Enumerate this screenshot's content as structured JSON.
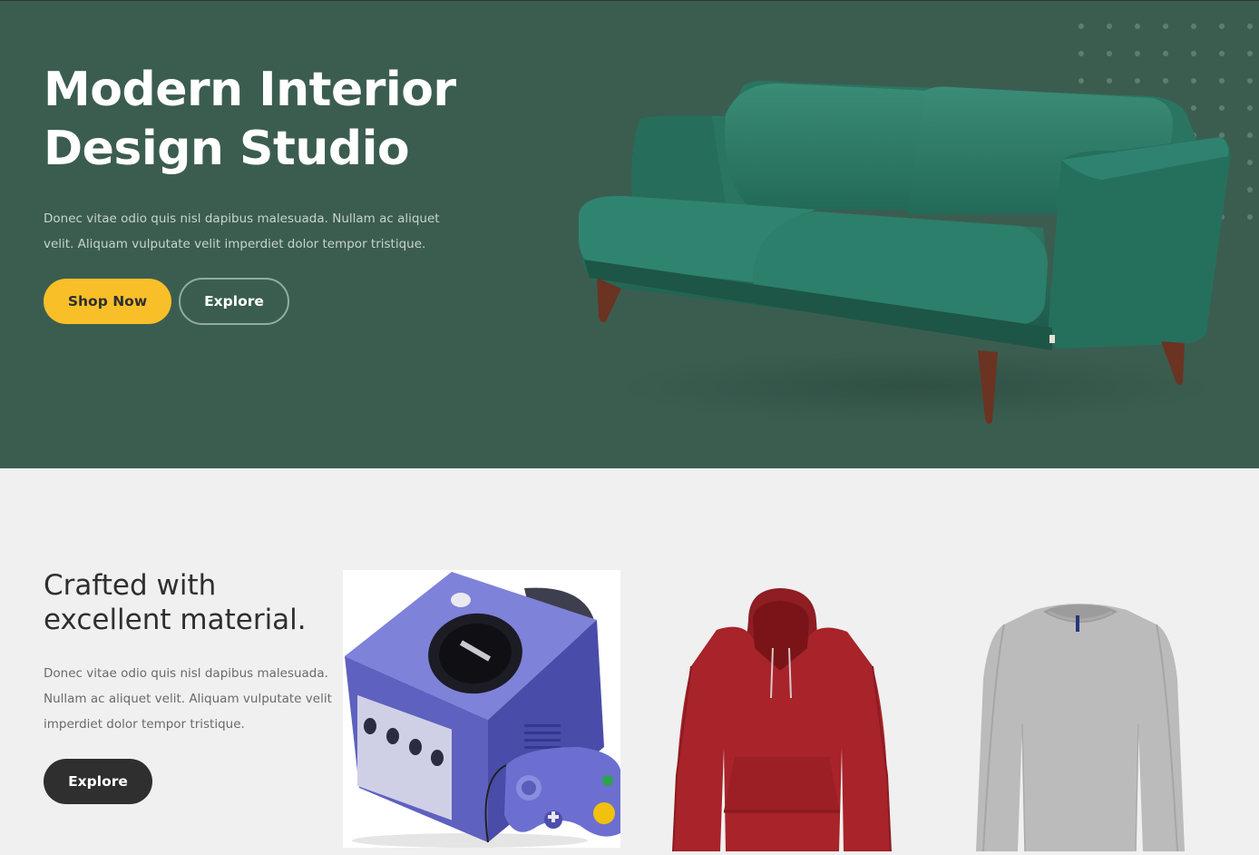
{
  "hero": {
    "title_line1": "Modern Interior",
    "title_line2": "Design Studio",
    "description": "Donec vitae odio quis nisl dapibus malesuada. Nullam ac aliquet velit. Aliquam vulputate velit imperdiet dolor tempor tristique.",
    "shop_now_label": "Shop Now",
    "explore_label": "Explore",
    "background_color": "#3b5d50",
    "accent_color": "#f9bf29",
    "image": "green-velvet-sofa"
  },
  "section": {
    "title_line1": "Crafted with",
    "title_line2": "excellent material.",
    "description": "Donec vitae odio quis nisl dapibus malesuada. Nullam ac aliquet velit. Aliquam vulputate velit imperdiet dolor tempor tristique.",
    "explore_label": "Explore",
    "products": [
      {
        "image": "purple-game-console",
        "color": "#6c6fc7"
      },
      {
        "image": "red-hoodie",
        "color": "#a8232a"
      },
      {
        "image": "grey-sweater",
        "color": "#b9b9b9"
      }
    ]
  }
}
